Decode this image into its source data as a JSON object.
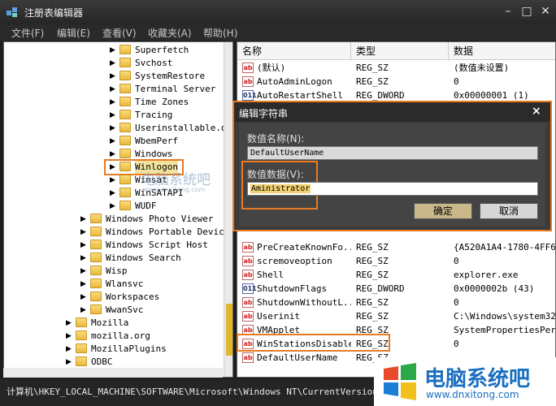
{
  "titlebar": {
    "title": "注册表编辑器",
    "minimize": "–",
    "maximize": "□",
    "close": "✕"
  },
  "menubar": [
    "文件(F)",
    "编辑(E)",
    "查看(V)",
    "收藏夹(A)",
    "帮助(H)"
  ],
  "tree": {
    "items": [
      {
        "label": "Superfetch",
        "level": 2
      },
      {
        "label": "Svchost",
        "level": 2
      },
      {
        "label": "SystemRestore",
        "level": 2
      },
      {
        "label": "Terminal Server",
        "level": 2
      },
      {
        "label": "Time Zones",
        "level": 2
      },
      {
        "label": "Tracing",
        "level": 2
      },
      {
        "label": "Userinstallable.d",
        "level": 2
      },
      {
        "label": "WbemPerf",
        "level": 2
      },
      {
        "label": "Windows",
        "level": 2
      },
      {
        "label": "Winlogon",
        "level": 2
      },
      {
        "label": "Winsat",
        "level": 2
      },
      {
        "label": "WinSATAPI",
        "level": 2
      },
      {
        "label": "WUDF",
        "level": 2
      },
      {
        "label": "Windows Photo Viewer",
        "level": 1
      },
      {
        "label": "Windows Portable Device",
        "level": 1
      },
      {
        "label": "Windows Script Host",
        "level": 1
      },
      {
        "label": "Windows Search",
        "level": 1
      },
      {
        "label": "Wisp",
        "level": 1
      },
      {
        "label": "Wlansvc",
        "level": 1
      },
      {
        "label": "Workspaces",
        "level": 1
      },
      {
        "label": "WwanSvc",
        "level": 1
      },
      {
        "label": "Mozilla",
        "level": 0
      },
      {
        "label": "mozilla.org",
        "level": 0
      },
      {
        "label": "MozillaPlugins",
        "level": 0
      },
      {
        "label": "ODBC",
        "level": 0
      }
    ]
  },
  "list": {
    "columns": [
      "名称",
      "类型",
      "数据"
    ],
    "rows": [
      {
        "name": "(默认)",
        "type": "REG_SZ",
        "data": "(数值未设置)",
        "kind": "ab"
      },
      {
        "name": "AutoAdminLogon",
        "type": "REG_SZ",
        "data": "0",
        "kind": "ab"
      },
      {
        "name": "AutoRestartShell",
        "type": "REG_DWORD",
        "data": "0x00000001 (1)",
        "kind": "bin"
      },
      {
        "name": "",
        "type": "",
        "data": "",
        "kind": "none"
      },
      {
        "name": "",
        "type": "",
        "data": "",
        "kind": "none"
      },
      {
        "name": "",
        "type": "",
        "data": "",
        "kind": "none"
      },
      {
        "name": "",
        "type": "",
        "data": "",
        "kind": "none"
      },
      {
        "name": "",
        "type": "",
        "data": "",
        "kind": "none"
      },
      {
        "name": "",
        "type": "",
        "data": "",
        "kind": "none"
      },
      {
        "name": "",
        "type": "",
        "data": "",
        "kind": "none"
      },
      {
        "name": "",
        "type": "",
        "data": "",
        "kind": "none"
      },
      {
        "name": "",
        "type": "",
        "data": "",
        "kind": "none"
      },
      {
        "name": "",
        "type": "",
        "data": "",
        "kind": "none"
      },
      {
        "name": "PreCreateKnownFo...",
        "type": "REG_SZ",
        "data": "{A520A1A4-1780-4FF6",
        "kind": "ab"
      },
      {
        "name": "scremoveoption",
        "type": "REG_SZ",
        "data": "0",
        "kind": "ab"
      },
      {
        "name": "Shell",
        "type": "REG_SZ",
        "data": "explorer.exe",
        "kind": "ab"
      },
      {
        "name": "ShutdownFlags",
        "type": "REG_DWORD",
        "data": "0x0000002b (43)",
        "kind": "bin"
      },
      {
        "name": "ShutdownWithoutL...",
        "type": "REG_SZ",
        "data": "0",
        "kind": "ab"
      },
      {
        "name": "Userinit",
        "type": "REG_SZ",
        "data": "C:\\Windows\\system32\\",
        "kind": "ab"
      },
      {
        "name": "VMApplet",
        "type": "REG_SZ",
        "data": "SystemPropertiesPerf",
        "kind": "ab"
      },
      {
        "name": "WinStationsDisabled",
        "type": "REG_SZ",
        "data": "0",
        "kind": "ab"
      },
      {
        "name": "DefaultUserName",
        "type": "REG_SZ",
        "data": "",
        "kind": "ab"
      }
    ]
  },
  "statusbar": {
    "path": "计算机\\HKEY_LOCAL_MACHINE\\SOFTWARE\\Microsoft\\Windows NT\\CurrentVersion\\Winlo"
  },
  "dialog": {
    "title": "编辑字符串",
    "close": "×",
    "name_label": "数值名称(N):",
    "name_value": "DefaultUserName",
    "data_label": "数值数据(V):",
    "data_value": "Aministrator",
    "ok": "确定",
    "cancel": "取消"
  },
  "watermark": {
    "text": "电脑系统吧",
    "url": "www.dnxitong.com",
    "faint_text": "电脑系统吧",
    "faint_url": "www.dnxitong.com"
  },
  "colors": {
    "accent": "#e87a22",
    "folder": "#f0c850",
    "selection": "#e0b82c"
  }
}
